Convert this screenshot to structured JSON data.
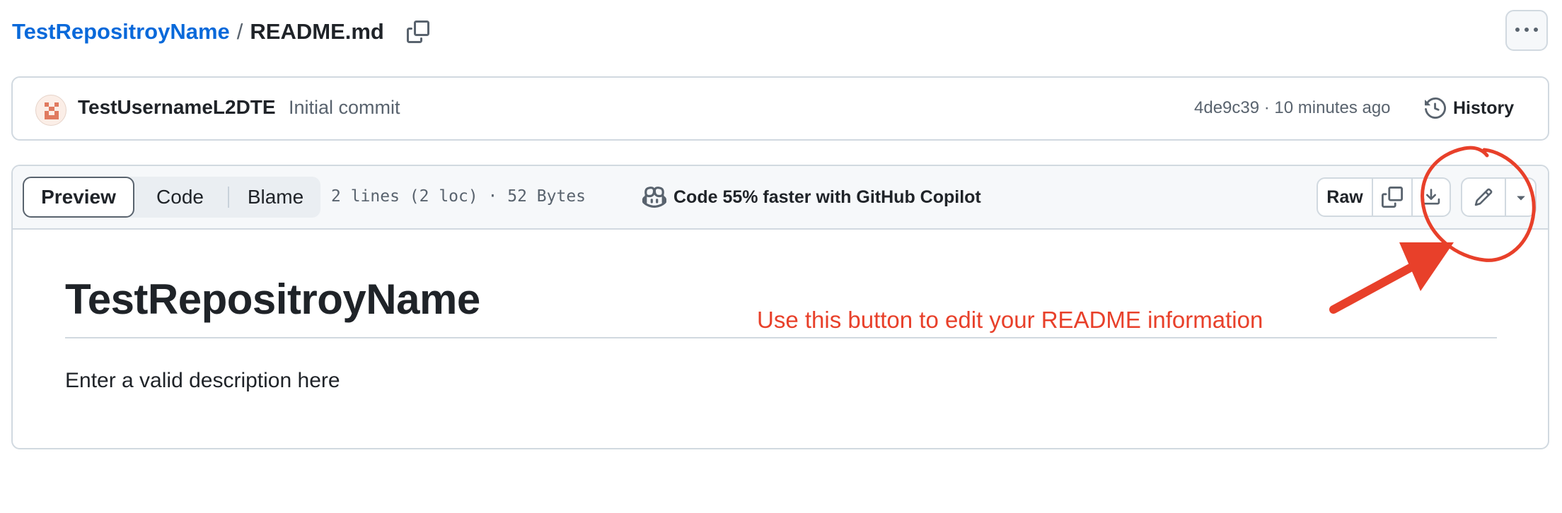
{
  "breadcrumb": {
    "repo": "TestRepositroyName",
    "separator": "/",
    "file": "README.md"
  },
  "icons": {
    "copy_path": "copy-icon",
    "more": "kebab-horizontal-icon",
    "history": "history-icon",
    "copilot": "copilot-icon",
    "copy_raw": "copy-icon",
    "download": "download-icon",
    "edit": "pencil-icon",
    "dropdown": "triangle-down-icon"
  },
  "commit": {
    "username": "TestUsernameL2DTE",
    "message": "Initial commit",
    "meta": "4de9c39 · 10 minutes ago",
    "history_label": "History"
  },
  "file_header": {
    "tabs": {
      "preview": "Preview",
      "code": "Code",
      "blame": "Blame"
    },
    "active_tab": "Preview",
    "info": "2 lines (2 loc) · 52 Bytes",
    "copilot_label": "Code 55% faster with GitHub Copilot",
    "raw_label": "Raw"
  },
  "readme": {
    "title": "TestRepositroyName",
    "description": "Enter a valid description here"
  },
  "annotation": {
    "text": "Use this button to edit your README information",
    "color": "#e8402a"
  },
  "colors": {
    "link": "#0969da",
    "text": "#1f2328",
    "muted": "#59636e",
    "border": "#d1d9e0",
    "header_bg": "#f6f8fa"
  }
}
